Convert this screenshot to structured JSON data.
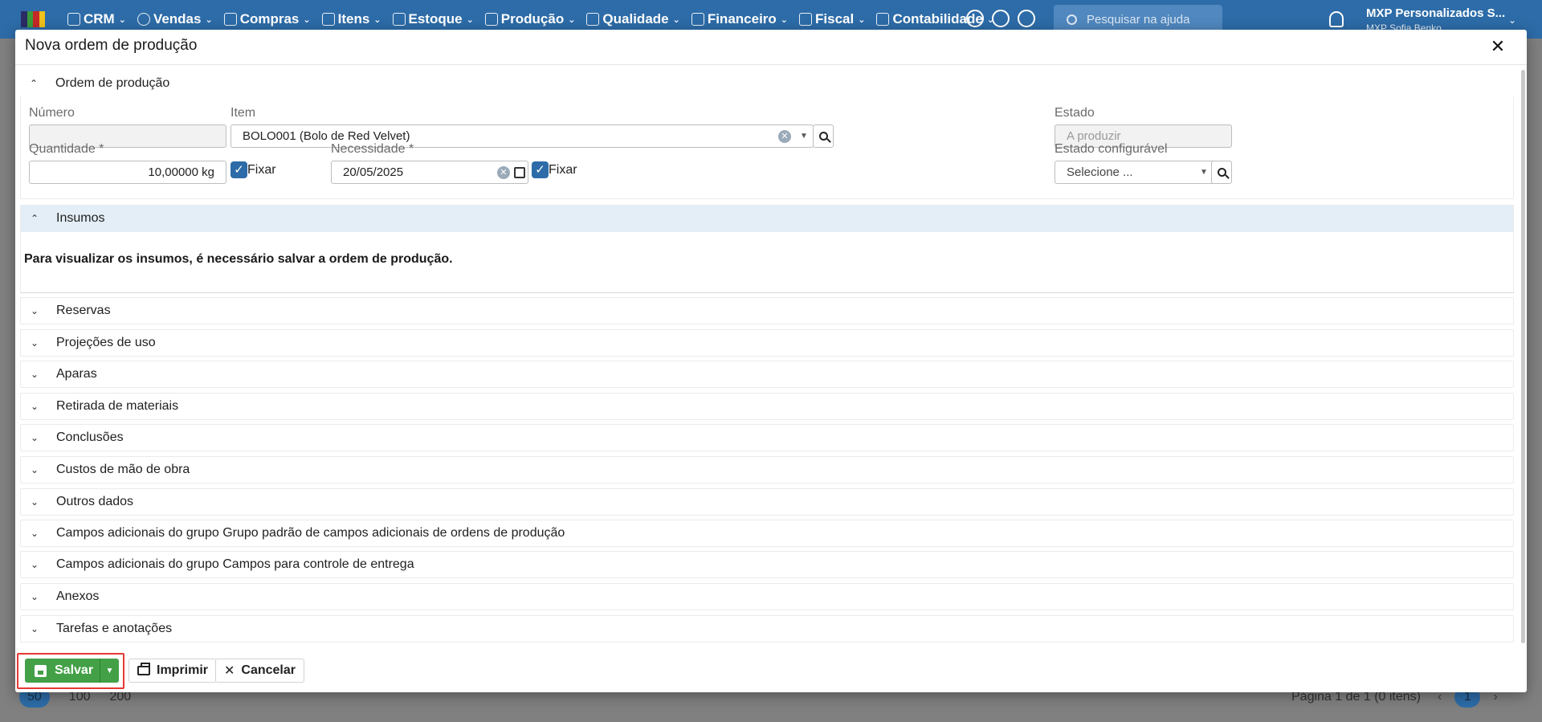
{
  "topbar": {
    "nav": [
      {
        "label": "CRM"
      },
      {
        "label": "Vendas"
      },
      {
        "label": "Compras"
      },
      {
        "label": "Itens"
      },
      {
        "label": "Estoque"
      },
      {
        "label": "Produção"
      },
      {
        "label": "Qualidade"
      },
      {
        "label": "Financeiro"
      },
      {
        "label": "Fiscal"
      },
      {
        "label": "Contabilidade"
      }
    ],
    "search_placeholder": "Pesquisar na ajuda",
    "company": "MXP Personalizados S...",
    "user": "MXP Sofia Benko",
    "icons": [
      "gear-icon",
      "help-icon",
      "chat-icon",
      "bell-icon"
    ],
    "color": "#2d6ca8"
  },
  "background": {
    "page_sizes": [
      "50",
      "100",
      "200"
    ],
    "page_info": "Página 1 de 1 (0 itens)",
    "current_page": "1"
  },
  "modal": {
    "title": "Nova ordem de produção",
    "sections": {
      "ordem": "Ordem de produção",
      "insumos": "Insumos"
    },
    "fields": {
      "numero_label": "Número",
      "numero_value": "",
      "item_label": "Item",
      "item_value": "BOLO001 (Bolo de Red Velvet)",
      "estado_label": "Estado",
      "estado_value": "A produzir",
      "quantidade_label": "Quantidade *",
      "quantidade_value": "10,00000 kg",
      "fixar_label": "Fixar",
      "necessidade_label": "Necessidade *",
      "necessidade_value": "20/05/2025",
      "fixar2_label": "Fixar",
      "estado_config_label": "Estado configurável",
      "estado_config_placeholder": "Selecione ..."
    },
    "insumos_message": "Para visualizar os insumos, é necessário salvar a ordem de produção.",
    "collapsed_sections": [
      "Reservas",
      "Projeções de uso",
      "Aparas",
      "Retirada de materiais",
      "Conclusões",
      "Custos de mão de obra",
      "Outros dados",
      "Campos adicionais do grupo Grupo padrão de campos adicionais de ordens de produção",
      "Campos adicionais do grupo Campos para controle de entrega",
      "Anexos",
      "Tarefas e anotações"
    ],
    "buttons": {
      "save": "Salvar",
      "print": "Imprimir",
      "cancel": "Cancelar"
    },
    "colors": {
      "save": "#43a047",
      "checkbox": "#2d6ca8",
      "highlight": "#e53935"
    }
  }
}
